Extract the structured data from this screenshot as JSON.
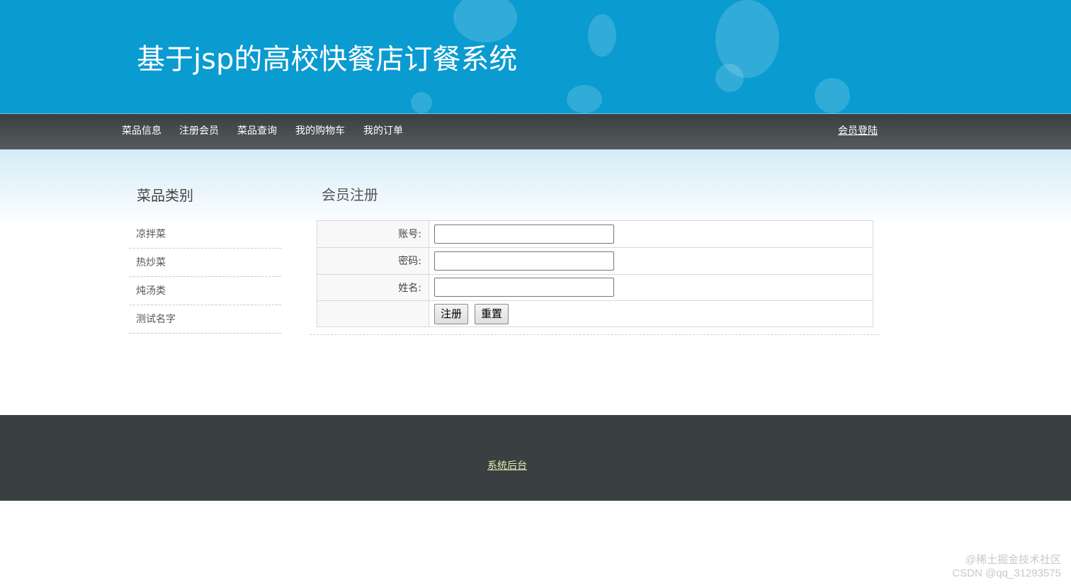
{
  "header": {
    "title": "基于jsp的高校快餐店订餐系统"
  },
  "nav": {
    "items": [
      {
        "label": "菜品信息"
      },
      {
        "label": "注册会员"
      },
      {
        "label": "菜品查询"
      },
      {
        "label": "我的购物车"
      },
      {
        "label": "我的订单"
      }
    ],
    "login_label": "会员登陆"
  },
  "sidebar": {
    "title": "菜品类别",
    "categories": [
      {
        "label": "凉拌菜"
      },
      {
        "label": "热炒菜"
      },
      {
        "label": "炖汤类"
      },
      {
        "label": "测试名字"
      }
    ]
  },
  "main": {
    "title": "会员注册",
    "form": {
      "fields": [
        {
          "label": "账号:",
          "value": ""
        },
        {
          "label": "密码:",
          "value": ""
        },
        {
          "label": "姓名:",
          "value": ""
        }
      ],
      "submit_label": "注册",
      "reset_label": "重置"
    }
  },
  "footer": {
    "admin_link": "系统后台"
  },
  "watermark": {
    "line1": "@稀土掘金技术社区",
    "line2": "CSDN @qq_31293575"
  },
  "colors": {
    "banner": "#0a9bd0",
    "navbar": "#45494c",
    "footer": "#3a3f41",
    "footer_link": "#e6ecb0"
  }
}
